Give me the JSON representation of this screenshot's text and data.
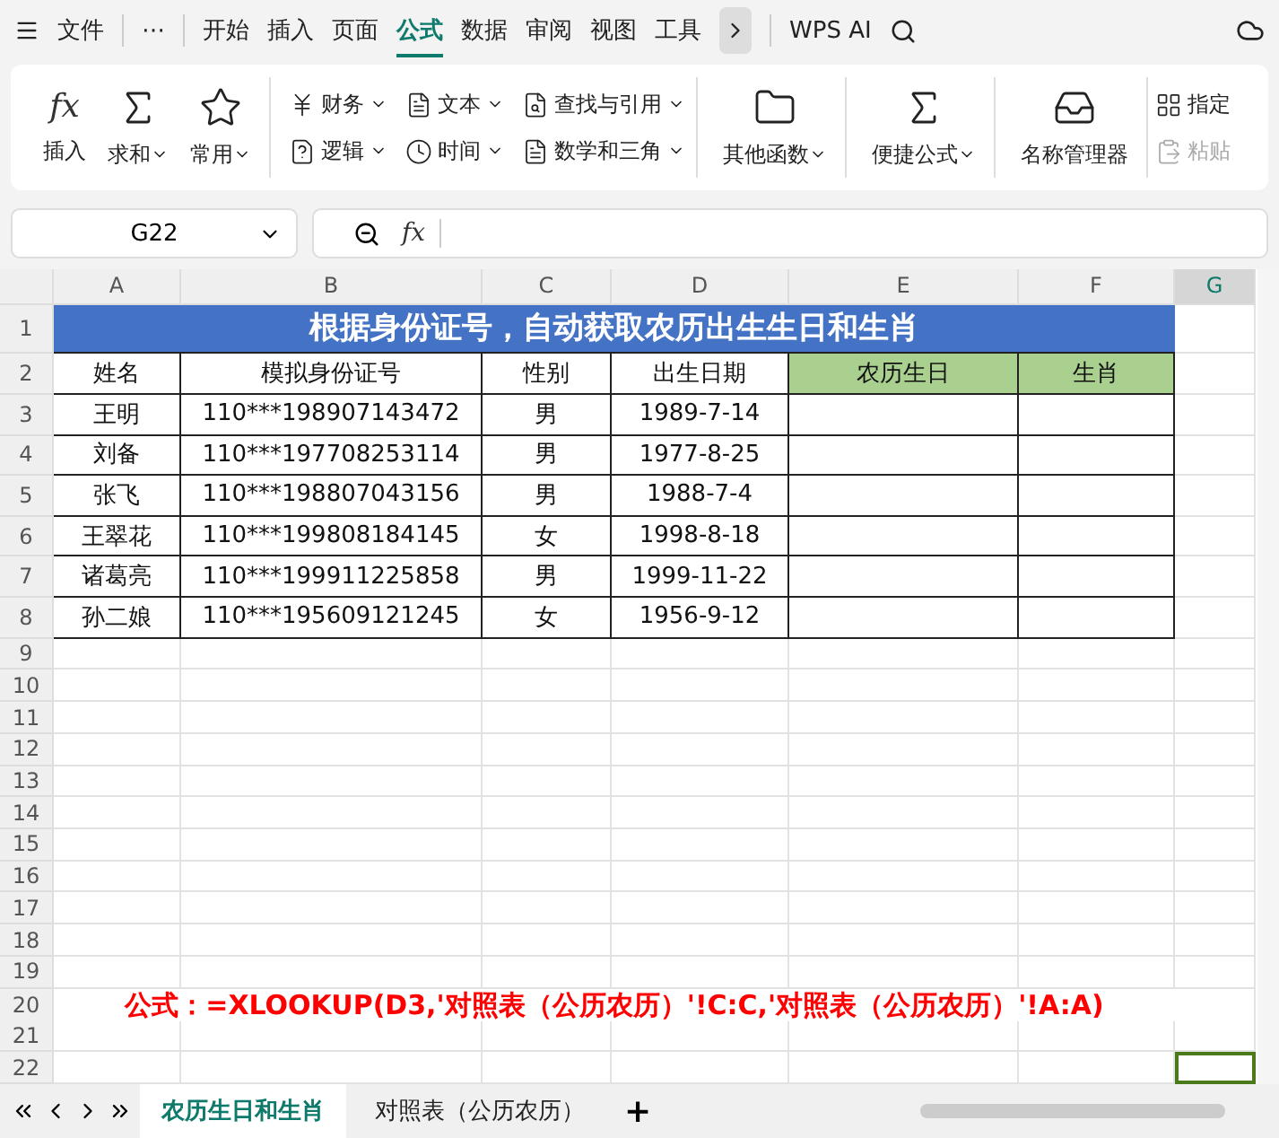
{
  "menu": {
    "file": "文件",
    "more": "⋯",
    "tabs": [
      {
        "label": "开始",
        "selected": false
      },
      {
        "label": "插入",
        "selected": false
      },
      {
        "label": "页面",
        "selected": false
      },
      {
        "label": "公式",
        "selected": true
      },
      {
        "label": "数据",
        "selected": false
      },
      {
        "label": "审阅",
        "selected": false
      },
      {
        "label": "视图",
        "selected": false
      },
      {
        "label": "工具",
        "selected": false
      }
    ],
    "ai": "WPS AI"
  },
  "ribbon": {
    "fx_symbol": "fx",
    "groups": [
      {
        "kind": "big",
        "items": [
          {
            "label": "插入",
            "caret": false
          },
          {
            "label": "求和",
            "caret": true
          },
          {
            "label": "常用",
            "caret": true
          }
        ]
      },
      {
        "kind": "small",
        "items": [
          {
            "label": "财务"
          },
          {
            "label": "逻辑"
          },
          {
            "label": "文本"
          },
          {
            "label": "时间"
          },
          {
            "label": "查找与引用"
          },
          {
            "label": "数学和三角"
          }
        ]
      },
      {
        "kind": "big",
        "items": [
          {
            "label": "其他函数",
            "caret": true
          }
        ]
      },
      {
        "kind": "big",
        "items": [
          {
            "label": "便捷公式",
            "caret": true
          }
        ]
      },
      {
        "kind": "big",
        "items": [
          {
            "label": "名称管理器",
            "caret": false
          }
        ]
      },
      {
        "kind": "cut",
        "items": [
          {
            "label": "指定",
            "disabled": false
          },
          {
            "label": "粘贴",
            "disabled": true
          }
        ]
      }
    ]
  },
  "formula_bar": {
    "name_box": "G22",
    "fx": "fx"
  },
  "columns": [
    {
      "label": "A",
      "selected": false
    },
    {
      "label": "B",
      "selected": false
    },
    {
      "label": "C",
      "selected": false
    },
    {
      "label": "D",
      "selected": false
    },
    {
      "label": "E",
      "selected": false
    },
    {
      "label": "F",
      "selected": false
    },
    {
      "label": "G",
      "selected": true
    }
  ],
  "row_numbers": [
    "1",
    "2",
    "3",
    "4",
    "5",
    "6",
    "7",
    "8",
    "9",
    "10",
    "11",
    "12",
    "13",
    "14",
    "15",
    "16",
    "17",
    "18",
    "19",
    "20",
    "21",
    "22"
  ],
  "table": {
    "title": "根据身份证号，自动获取农历出生生日和生肖",
    "header": [
      {
        "text": "姓名",
        "highlight": false
      },
      {
        "text": "模拟身份证号",
        "highlight": false
      },
      {
        "text": "性别",
        "highlight": false
      },
      {
        "text": "出生日期",
        "highlight": false
      },
      {
        "text": "农历生日",
        "highlight": true
      },
      {
        "text": "生肖",
        "highlight": true
      }
    ],
    "rows": [
      [
        "王明",
        "110***198907143472",
        "男",
        "1989-7-14",
        "",
        ""
      ],
      [
        "刘备",
        "110***197708253114",
        "男",
        "1977-8-25",
        "",
        ""
      ],
      [
        "张飞",
        "110***198807043156",
        "男",
        "1988-7-4",
        "",
        ""
      ],
      [
        "王翠花",
        "110***199808184145",
        "女",
        "1998-8-18",
        "",
        ""
      ],
      [
        "诸葛亮",
        "110***199911225858",
        "男",
        "1999-11-22",
        "",
        ""
      ],
      [
        "孙二娘",
        "110***195609121245",
        "女",
        "1956-9-12",
        "",
        ""
      ]
    ]
  },
  "note": "公式：=XLOOKUP(D3,'对照表（公历农历）'!C:C,'对照表（公历农历）'!A:A)",
  "sheet_tabs": [
    {
      "label": "农历生日和生肖",
      "selected": true
    },
    {
      "label": "对照表（公历农历）",
      "selected": false
    }
  ],
  "add_sheet": "+"
}
